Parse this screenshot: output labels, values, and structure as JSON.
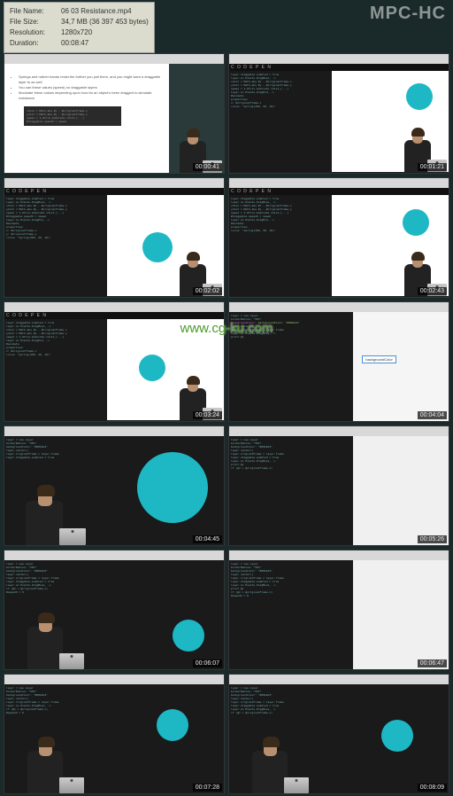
{
  "app_title": "MPC-HC",
  "info": {
    "label_file": "File Name:",
    "filename": "06 03 Resistance.mp4",
    "label_size": "File Size:",
    "filesize": "34,7 MB (36 397 453 bytes)",
    "label_res": "Resolution:",
    "resolution": "1280x720",
    "label_dur": "Duration:",
    "duration": "00:08:47"
  },
  "watermark_url": "www.cg-ku.com",
  "codepen_label": "C O D E P E N",
  "slide": {
    "b1": "Springs and rubber bands resist the further you pull them, and you might want a draggable layer to as well",
    "b2": "You can these values (speed) on draggable layers",
    "b3": "Modulate these values depending upon how far an object's been dragged to simulate resistance"
  },
  "thumbs": [
    {
      "ts": "00:00:41"
    },
    {
      "ts": "00:01:21"
    },
    {
      "ts": "00:02:02"
    },
    {
      "ts": "00:02:43"
    },
    {
      "ts": "00:03:24"
    },
    {
      "ts": "00:04:04"
    },
    {
      "ts": "00:04:45"
    },
    {
      "ts": "00:05:26"
    },
    {
      "ts": "00:06:07"
    },
    {
      "ts": "00:06:47"
    },
    {
      "ts": "00:07:28"
    },
    {
      "ts": "00:08:09"
    }
  ],
  "code": {
    "l1": "layer.draggable.enabled = true",
    "l2": "layer.on Events.DragMove, ->",
    "l3": "  xdist = Math.abs #x - #originalFrame.x",
    "l4": "  ydist = Math.abs #y - #originalFrame.y",
    "l5": "  speed = 1-Utils.modulate xdist,[...]",
    "l6": "  #draggable.speedX = speed",
    "l7": "layer.on Events.DragEnd, ->",
    "l8": "  #animate",
    "l9": "    properties:",
    "l10": "      x: #originalFrame.x",
    "l11": "      y: #originalFrame.y",
    "l12": "    curve: \"spring(200, 20, 10)\"",
    "alt1": "layer = new Layer",
    "alt2": "  borderRadius: \"50%\"",
    "alt3": "  backgroundColor: \"#00bbd4\"",
    "alt4": "layer.center()",
    "alt5": "layer.originalFrame = layer.frame",
    "alt6": "layer.draggable.enabled = true",
    "alt7": "layer.on Events.DragMove, ->",
    "alt8": "  print @x",
    "alt9": "  if (@x > @originalFrame.x)",
    "alt10": "    #speedX = 0"
  }
}
